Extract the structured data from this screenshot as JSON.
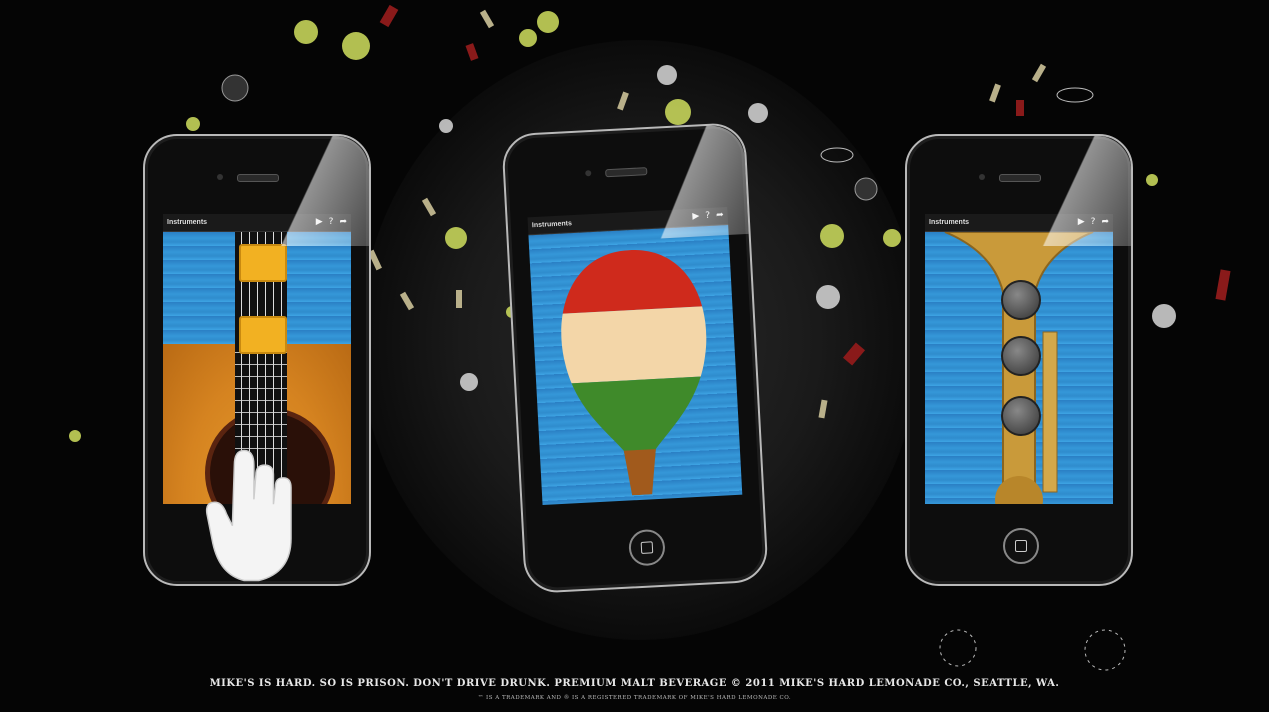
{
  "phones": {
    "left": {
      "app_title": "Instruments",
      "instrument": "guitar"
    },
    "center": {
      "app_title": "Instruments",
      "instrument": "maraca"
    },
    "right": {
      "app_title": "Instruments",
      "instrument": "trumpet"
    }
  },
  "toolbar_icons": [
    "play-icon",
    "help-icon",
    "share-icon"
  ],
  "toolbar_glyphs": {
    "play": "▶",
    "help": "?",
    "share": "➦"
  },
  "legal": {
    "main": "MIKE'S IS HARD. SO IS PRISON. DON'T DRIVE DRUNK. PREMIUM MALT BEVERAGE © 2011 MIKE'S HARD LEMONADE CO., SEATTLE, WA.",
    "sub": "™ IS A TRADEMARK AND ® IS A REGISTERED TRADEMARK OF MIKE'S HARD LEMONADE CO."
  },
  "colors": {
    "background": "#050505",
    "screen_blue": "#3597d8",
    "guitar_wood": "#d58320",
    "chord_pad": "#f2b122",
    "maraca_red": "#cf2a1c",
    "maraca_cream": "#f3d6a8",
    "maraca_green": "#3f8a2a",
    "trumpet_gold": "#c99a3a",
    "valve_gray": "#555555"
  }
}
